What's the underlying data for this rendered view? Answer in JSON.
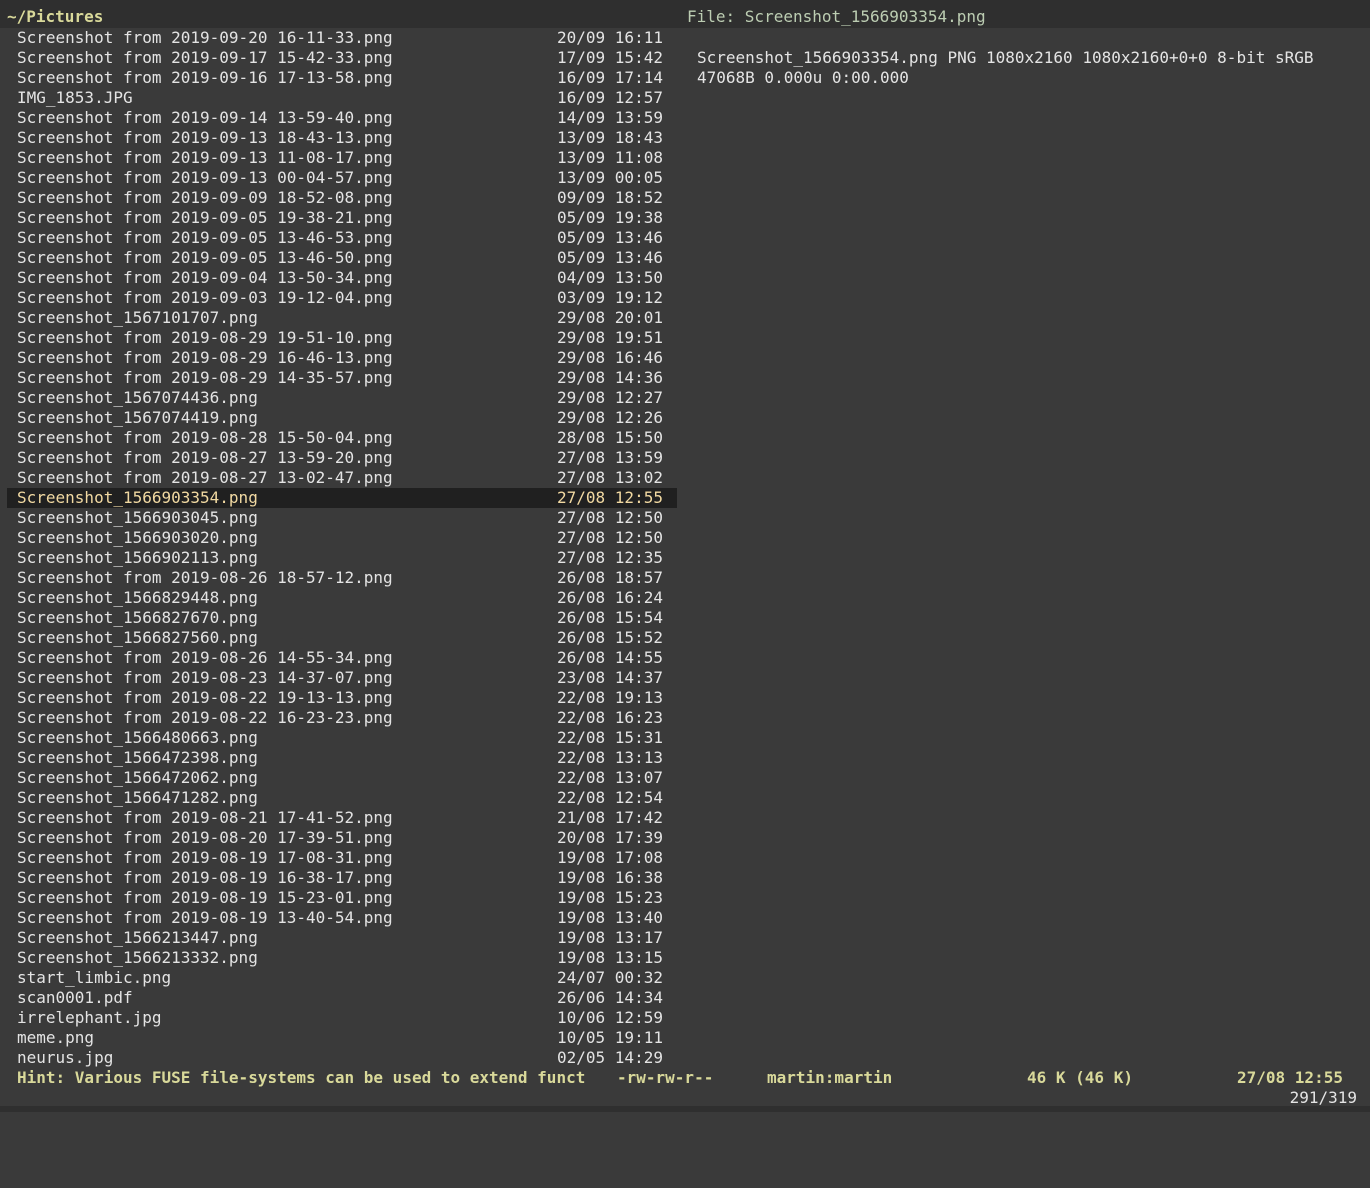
{
  "header": {
    "path": "~/Pictures",
    "preview_title": "File: Screenshot_1566903354.png"
  },
  "files": [
    {
      "name": "Screenshot from 2019-09-20 16-11-33.png",
      "date": "20/09 16:11"
    },
    {
      "name": "Screenshot from 2019-09-17 15-42-33.png",
      "date": "17/09 15:42"
    },
    {
      "name": "Screenshot from 2019-09-16 17-13-58.png",
      "date": "16/09 17:14"
    },
    {
      "name": "IMG_1853.JPG",
      "date": "16/09 12:57"
    },
    {
      "name": "Screenshot from 2019-09-14 13-59-40.png",
      "date": "14/09 13:59"
    },
    {
      "name": "Screenshot from 2019-09-13 18-43-13.png",
      "date": "13/09 18:43"
    },
    {
      "name": "Screenshot from 2019-09-13 11-08-17.png",
      "date": "13/09 11:08"
    },
    {
      "name": "Screenshot from 2019-09-13 00-04-57.png",
      "date": "13/09 00:05"
    },
    {
      "name": "Screenshot from 2019-09-09 18-52-08.png",
      "date": "09/09 18:52"
    },
    {
      "name": "Screenshot from 2019-09-05 19-38-21.png",
      "date": "05/09 19:38"
    },
    {
      "name": "Screenshot from 2019-09-05 13-46-53.png",
      "date": "05/09 13:46"
    },
    {
      "name": "Screenshot from 2019-09-05 13-46-50.png",
      "date": "05/09 13:46"
    },
    {
      "name": "Screenshot from 2019-09-04 13-50-34.png",
      "date": "04/09 13:50"
    },
    {
      "name": "Screenshot from 2019-09-03 19-12-04.png",
      "date": "03/09 19:12"
    },
    {
      "name": "Screenshot_1567101707.png",
      "date": "29/08 20:01"
    },
    {
      "name": "Screenshot from 2019-08-29 19-51-10.png",
      "date": "29/08 19:51"
    },
    {
      "name": "Screenshot from 2019-08-29 16-46-13.png",
      "date": "29/08 16:46"
    },
    {
      "name": "Screenshot from 2019-08-29 14-35-57.png",
      "date": "29/08 14:36"
    },
    {
      "name": "Screenshot_1567074436.png",
      "date": "29/08 12:27"
    },
    {
      "name": "Screenshot_1567074419.png",
      "date": "29/08 12:26"
    },
    {
      "name": "Screenshot from 2019-08-28 15-50-04.png",
      "date": "28/08 15:50"
    },
    {
      "name": "Screenshot from 2019-08-27 13-59-20.png",
      "date": "27/08 13:59"
    },
    {
      "name": "Screenshot from 2019-08-27 13-02-47.png",
      "date": "27/08 13:02"
    },
    {
      "name": "Screenshot_1566903354.png",
      "date": "27/08 12:55",
      "selected": true
    },
    {
      "name": "Screenshot_1566903045.png",
      "date": "27/08 12:50"
    },
    {
      "name": "Screenshot_1566903020.png",
      "date": "27/08 12:50"
    },
    {
      "name": "Screenshot_1566902113.png",
      "date": "27/08 12:35"
    },
    {
      "name": "Screenshot from 2019-08-26 18-57-12.png",
      "date": "26/08 18:57"
    },
    {
      "name": "Screenshot_1566829448.png",
      "date": "26/08 16:24"
    },
    {
      "name": "Screenshot_1566827670.png",
      "date": "26/08 15:54"
    },
    {
      "name": "Screenshot_1566827560.png",
      "date": "26/08 15:52"
    },
    {
      "name": "Screenshot from 2019-08-26 14-55-34.png",
      "date": "26/08 14:55"
    },
    {
      "name": "Screenshot from 2019-08-23 14-37-07.png",
      "date": "23/08 14:37"
    },
    {
      "name": "Screenshot from 2019-08-22 19-13-13.png",
      "date": "22/08 19:13"
    },
    {
      "name": "Screenshot from 2019-08-22 16-23-23.png",
      "date": "22/08 16:23"
    },
    {
      "name": "Screenshot_1566480663.png",
      "date": "22/08 15:31"
    },
    {
      "name": "Screenshot_1566472398.png",
      "date": "22/08 13:13"
    },
    {
      "name": "Screenshot_1566472062.png",
      "date": "22/08 13:07"
    },
    {
      "name": "Screenshot_1566471282.png",
      "date": "22/08 12:54"
    },
    {
      "name": "Screenshot from 2019-08-21 17-41-52.png",
      "date": "21/08 17:42"
    },
    {
      "name": "Screenshot from 2019-08-20 17-39-51.png",
      "date": "20/08 17:39"
    },
    {
      "name": "Screenshot from 2019-08-19 17-08-31.png",
      "date": "19/08 17:08"
    },
    {
      "name": "Screenshot from 2019-08-19 16-38-17.png",
      "date": "19/08 16:38"
    },
    {
      "name": "Screenshot from 2019-08-19 15-23-01.png",
      "date": "19/08 15:23"
    },
    {
      "name": "Screenshot from 2019-08-19 13-40-54.png",
      "date": "19/08 13:40"
    },
    {
      "name": "Screenshot_1566213447.png",
      "date": "19/08 13:17"
    },
    {
      "name": "Screenshot_1566213332.png",
      "date": "19/08 13:15"
    },
    {
      "name": "start_limbic.png",
      "date": "24/07 00:32"
    },
    {
      "name": "scan0001.pdf",
      "date": "26/06 14:34"
    },
    {
      "name": "irrelephant.jpg",
      "date": "10/06 12:59"
    },
    {
      "name": "meme.png",
      "date": "10/05 19:11"
    },
    {
      "name": "neurus.jpg",
      "date": "02/05 14:29"
    }
  ],
  "preview": {
    "lines": [
      "Screenshot_1566903354.png PNG 1080x2160 1080x2160+0+0 8-bit sRGB",
      "47068B 0.000u 0:00.000"
    ]
  },
  "status": {
    "hint": "Hint: Various FUSE file-systems can be used to extend funct",
    "permissions": "-rw-rw-r--",
    "owner": "martin:martin",
    "size": "46 K (46 K)",
    "mtime": "27/08 12:55",
    "counter": "291/319"
  }
}
